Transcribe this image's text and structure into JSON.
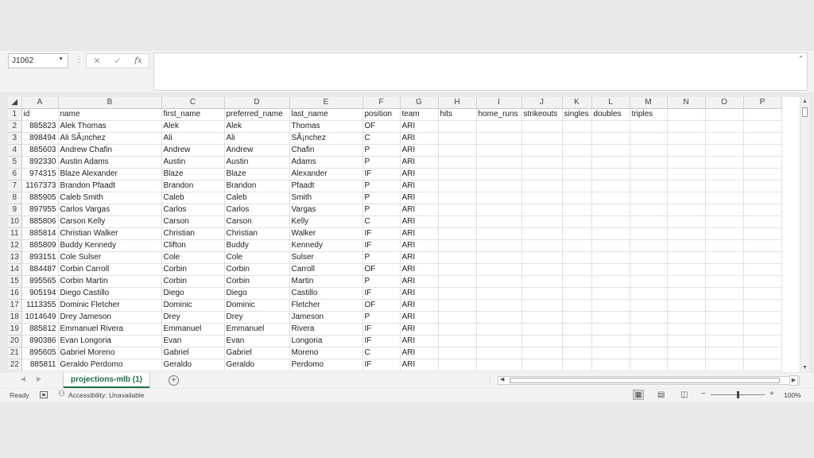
{
  "formula_bar": {
    "name_box": "J1062",
    "cancel_icon": "✕",
    "enter_icon": "✓",
    "fx_label": "fx",
    "formula": ""
  },
  "columns": [
    "A",
    "B",
    "C",
    "D",
    "E",
    "F",
    "G",
    "H",
    "I",
    "J",
    "K",
    "L",
    "M",
    "N",
    "O",
    "P"
  ],
  "rows": [
    [
      "id",
      "name",
      "first_name",
      "preferred_name",
      "last_name",
      "position",
      "team",
      "hits",
      "home_runs",
      "strikeouts",
      "singles",
      "doubles",
      "triples",
      "",
      "",
      ""
    ],
    [
      "885823",
      "Alek Thomas",
      "Alek",
      "Alek",
      "Thomas",
      "OF",
      "ARI",
      "",
      "",
      "",
      "",
      "",
      "",
      "",
      "",
      ""
    ],
    [
      "898494",
      "Ali SÃ¡nchez",
      "Ali",
      "Ali",
      "SÃ¡nchez",
      "C",
      "ARI",
      "",
      "",
      "",
      "",
      "",
      "",
      "",
      "",
      ""
    ],
    [
      "885603",
      "Andrew Chafin",
      "Andrew",
      "Andrew",
      "Chafin",
      "P",
      "ARI",
      "",
      "",
      "",
      "",
      "",
      "",
      "",
      "",
      ""
    ],
    [
      "892330",
      "Austin Adams",
      "Austin",
      "Austin",
      "Adams",
      "P",
      "ARI",
      "",
      "",
      "",
      "",
      "",
      "",
      "",
      "",
      ""
    ],
    [
      "974315",
      "Blaze Alexander",
      "Blaze",
      "Blaze",
      "Alexander",
      "IF",
      "ARI",
      "",
      "",
      "",
      "",
      "",
      "",
      "",
      "",
      ""
    ],
    [
      "1167373",
      "Brandon Pfaadt",
      "Brandon",
      "Brandon",
      "Pfaadt",
      "P",
      "ARI",
      "",
      "",
      "",
      "",
      "",
      "",
      "",
      "",
      ""
    ],
    [
      "885905",
      "Caleb Smith",
      "Caleb",
      "Caleb",
      "Smith",
      "P",
      "ARI",
      "",
      "",
      "",
      "",
      "",
      "",
      "",
      "",
      ""
    ],
    [
      "897955",
      "Carlos Vargas",
      "Carlos",
      "Carlos",
      "Vargas",
      "P",
      "ARI",
      "",
      "",
      "",
      "",
      "",
      "",
      "",
      "",
      ""
    ],
    [
      "885806",
      "Carson Kelly",
      "Carson",
      "Carson",
      "Kelly",
      "C",
      "ARI",
      "",
      "",
      "",
      "",
      "",
      "",
      "",
      "",
      ""
    ],
    [
      "885814",
      "Christian Walker",
      "Christian",
      "Christian",
      "Walker",
      "IF",
      "ARI",
      "",
      "",
      "",
      "",
      "",
      "",
      "",
      "",
      ""
    ],
    [
      "885809",
      "Buddy Kennedy",
      "Clifton",
      "Buddy",
      "Kennedy",
      "IF",
      "ARI",
      "",
      "",
      "",
      "",
      "",
      "",
      "",
      "",
      ""
    ],
    [
      "893151",
      "Cole Sulser",
      "Cole",
      "Cole",
      "Sulser",
      "P",
      "ARI",
      "",
      "",
      "",
      "",
      "",
      "",
      "",
      "",
      ""
    ],
    [
      "884487",
      "Corbin Carroll",
      "Corbin",
      "Corbin",
      "Carroll",
      "OF",
      "ARI",
      "",
      "",
      "",
      "",
      "",
      "",
      "",
      "",
      ""
    ],
    [
      "895565",
      "Corbin Martin",
      "Corbin",
      "Corbin",
      "Martin",
      "P",
      "ARI",
      "",
      "",
      "",
      "",
      "",
      "",
      "",
      "",
      ""
    ],
    [
      "905194",
      "Diego Castillo",
      "Diego",
      "Diego",
      "Castillo",
      "IF",
      "ARI",
      "",
      "",
      "",
      "",
      "",
      "",
      "",
      "",
      ""
    ],
    [
      "1113355",
      "Dominic Fletcher",
      "Dominic",
      "Dominic",
      "Fletcher",
      "OF",
      "ARI",
      "",
      "",
      "",
      "",
      "",
      "",
      "",
      "",
      ""
    ],
    [
      "1014649",
      "Drey Jameson",
      "Drey",
      "Drey",
      "Jameson",
      "P",
      "ARI",
      "",
      "",
      "",
      "",
      "",
      "",
      "",
      "",
      ""
    ],
    [
      "885812",
      "Emmanuel Rivera",
      "Emmanuel",
      "Emmanuel",
      "Rivera",
      "IF",
      "ARI",
      "",
      "",
      "",
      "",
      "",
      "",
      "",
      "",
      ""
    ],
    [
      "890386",
      "Evan Longoria",
      "Evan",
      "Evan",
      "Longoria",
      "IF",
      "ARI",
      "",
      "",
      "",
      "",
      "",
      "",
      "",
      "",
      ""
    ],
    [
      "895605",
      "Gabriel Moreno",
      "Gabriel",
      "Gabriel",
      "Moreno",
      "C",
      "ARI",
      "",
      "",
      "",
      "",
      "",
      "",
      "",
      "",
      ""
    ],
    [
      "885811",
      "Geraldo Perdomo",
      "Geraldo",
      "Geraldo",
      "Perdomo",
      "IF",
      "ARI",
      "",
      "",
      "",
      "",
      "",
      "",
      "",
      "",
      ""
    ]
  ],
  "sheet_tabs": [
    "projections-mlb (1)"
  ],
  "status": {
    "ready": "Ready",
    "accessibility": "Accessibility: Unavailable",
    "zoom": "100%",
    "zoom_fraction": 0.5
  },
  "icons": {
    "add_sheet": "plus-circle-icon",
    "macro": "macro-record-icon",
    "accessibility": "accessibility-icon",
    "view_normal": "normal-view-icon",
    "view_layout": "page-layout-icon",
    "view_break": "page-break-icon"
  },
  "colors": {
    "sheet_tab_accent": "#1e7145",
    "header_bg": "#f2f2f2",
    "gridline": "#e1e1e1"
  }
}
